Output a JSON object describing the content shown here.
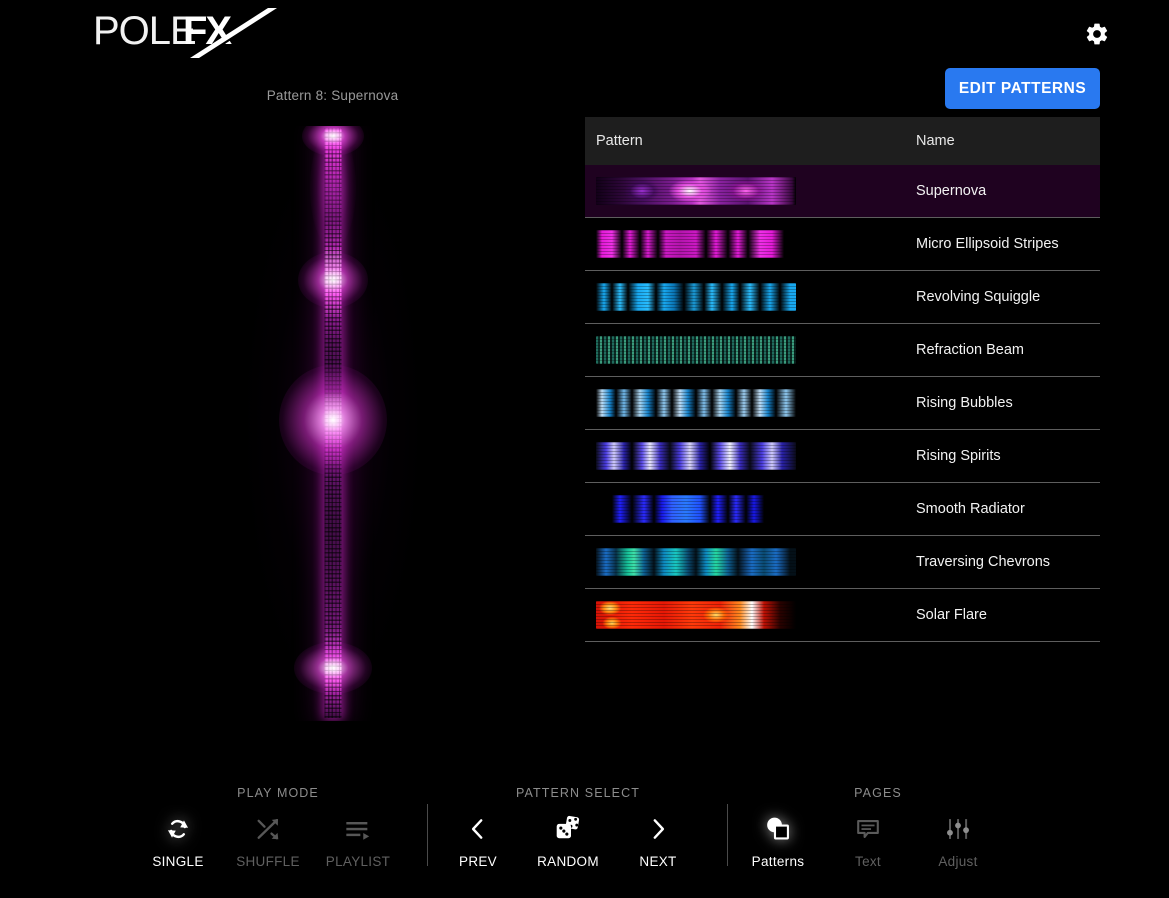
{
  "app": {
    "logo_text_light": "POLE",
    "logo_text_bold": "FX",
    "background_color": "#000000",
    "accent_color": "#2979f0"
  },
  "header": {
    "settings_icon": "gear-icon",
    "edit_patterns_label": "EDIT PATTERNS"
  },
  "viewer": {
    "current_pattern_label": "Pattern 8: Supernova",
    "pattern_number": 8,
    "pattern_name": "Supernova",
    "pole_colors": [
      "#ff5ef5",
      "#ffffff",
      "#c92fc0",
      "#8a1c8c",
      "#6d1570",
      "#430e48"
    ]
  },
  "pattern_table": {
    "columns": [
      "Pattern",
      "Name"
    ],
    "rows": [
      {
        "name": "Supernova",
        "thumb": "t-supernova",
        "selected": true
      },
      {
        "name": "Micro Ellipsoid Stripes",
        "thumb": "t-micro",
        "selected": false
      },
      {
        "name": "Revolving Squiggle",
        "thumb": "t-revolving",
        "selected": false
      },
      {
        "name": "Refraction Beam",
        "thumb": "t-refraction",
        "selected": false
      },
      {
        "name": "Rising Bubbles",
        "thumb": "t-bubbles",
        "selected": false
      },
      {
        "name": "Rising Spirits",
        "thumb": "t-spirits",
        "selected": false
      },
      {
        "name": "Smooth Radiator",
        "thumb": "t-radiator",
        "selected": false
      },
      {
        "name": "Traversing Chevrons",
        "thumb": "t-chevrons",
        "selected": false
      },
      {
        "name": "Solar Flare",
        "thumb": "t-solar",
        "selected": false
      }
    ]
  },
  "controls": {
    "play_mode": {
      "title": "PLAY MODE",
      "items": [
        {
          "label": "SINGLE",
          "icon": "repeat-single-icon",
          "active": true
        },
        {
          "label": "SHUFFLE",
          "icon": "shuffle-icon",
          "active": false
        },
        {
          "label": "PLAYLIST",
          "icon": "playlist-icon",
          "active": false
        }
      ]
    },
    "pattern_select": {
      "title": "PATTERN SELECT",
      "items": [
        {
          "label": "PREV",
          "icon": "chevron-left-icon",
          "active": false
        },
        {
          "label": "RANDOM",
          "icon": "dice-icon",
          "active": false
        },
        {
          "label": "NEXT",
          "icon": "chevron-right-icon",
          "active": false
        }
      ]
    },
    "pages": {
      "title": "PAGES",
      "items": [
        {
          "label": "Patterns",
          "icon": "shapes-icon",
          "active": true
        },
        {
          "label": "Text",
          "icon": "speech-bubble-icon",
          "active": false
        },
        {
          "label": "Adjust",
          "icon": "sliders-icon",
          "active": false
        }
      ]
    }
  }
}
